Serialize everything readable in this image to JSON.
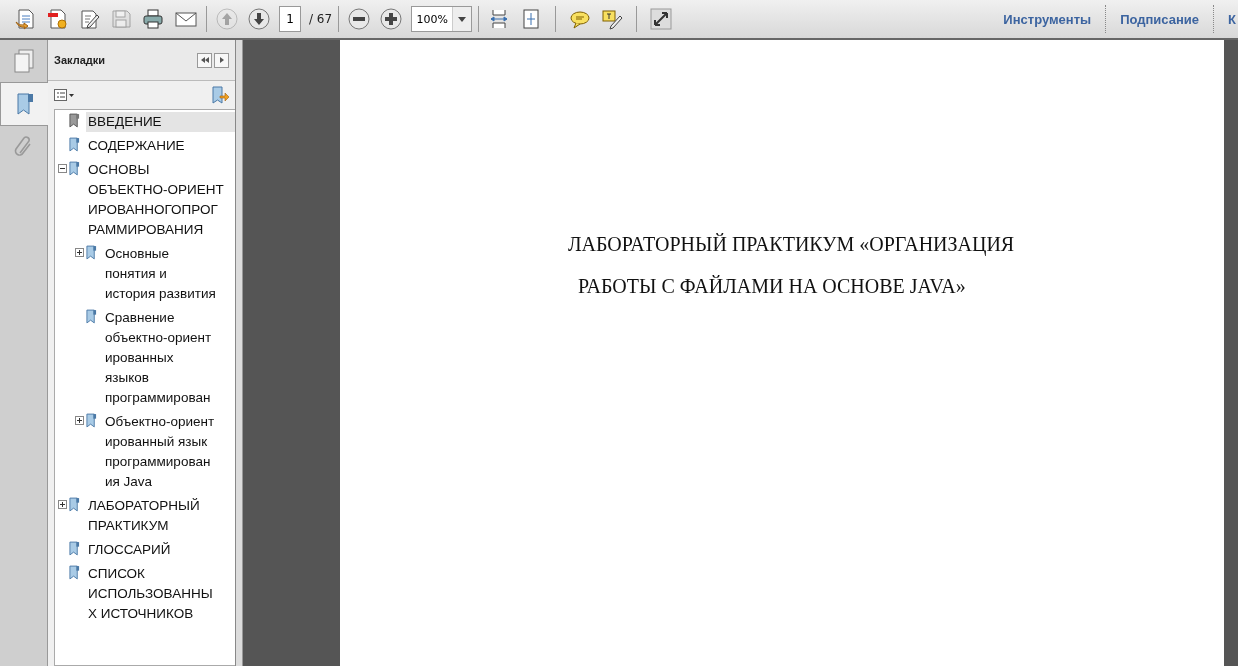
{
  "toolbar": {
    "buttons": [
      {
        "disabled": false
      },
      {
        "disabled": false
      },
      {
        "disabled": false
      },
      {
        "disabled": true
      },
      {
        "disabled": false
      },
      {
        "disabled": false
      }
    ],
    "nav_buttons": [
      {
        "disabled": true
      },
      {
        "disabled": false
      }
    ],
    "page_number": "1",
    "page_total": "/ 67",
    "zoom": "100%",
    "right_tabs": [
      "Инструменты",
      "Подписание",
      "К"
    ]
  },
  "side_tabs": [
    {
      "selected": false
    },
    {
      "selected": true
    },
    {
      "selected": false
    }
  ],
  "bookmarks_panel": {
    "title": "Закладки",
    "items": [
      {
        "lines": [
          "ВВЕДЕНИЕ"
        ],
        "kind": "leaf",
        "selected": true
      },
      {
        "lines": [
          "СОДЕРЖАНИЕ"
        ],
        "kind": "leaf",
        "selected": false
      },
      {
        "lines": [
          "ОСНОВЫ",
          "ОБЪЕКТНО-ОРИЕНТ",
          "ИРОВАННОГОПРОГ",
          "РАММИРОВАНИЯ"
        ],
        "kind": "folder",
        "expanded": true,
        "selected": false,
        "children": [
          {
            "lines": [
              "Основные",
              "понятия и",
              "история развития"
            ],
            "kind": "folder",
            "expanded": false,
            "selected": false
          },
          {
            "lines": [
              "Сравнение",
              "объектно-ориент",
              "ированных",
              "языков",
              "программирован"
            ],
            "kind": "leaf",
            "selected": false
          },
          {
            "lines": [
              "Объектно-ориент",
              "ированный язык",
              "программирован",
              "ия Java"
            ],
            "kind": "folder",
            "expanded": false,
            "selected": false
          }
        ]
      },
      {
        "lines": [
          "ЛАБОРАТОРНЫЙ",
          "ПРАКТИКУМ"
        ],
        "kind": "folder",
        "expanded": false,
        "selected": false
      },
      {
        "lines": [
          "ГЛОССАРИЙ"
        ],
        "kind": "leaf",
        "selected": false
      },
      {
        "lines": [
          "СПИСОК",
          "ИСПОЛЬЗОВАННЫ",
          "Х ИСТОЧНИКОВ"
        ],
        "kind": "leaf",
        "selected": false
      }
    ]
  },
  "document": {
    "title_lines": [
      "ЛАБОРАТОРНЫЙ ПРАКТИКУМ «ОРГАНИЗАЦИЯ",
      "РАБОТЫ С ФАЙЛАМИ НА ОСНОВЕ JAVA»"
    ]
  }
}
